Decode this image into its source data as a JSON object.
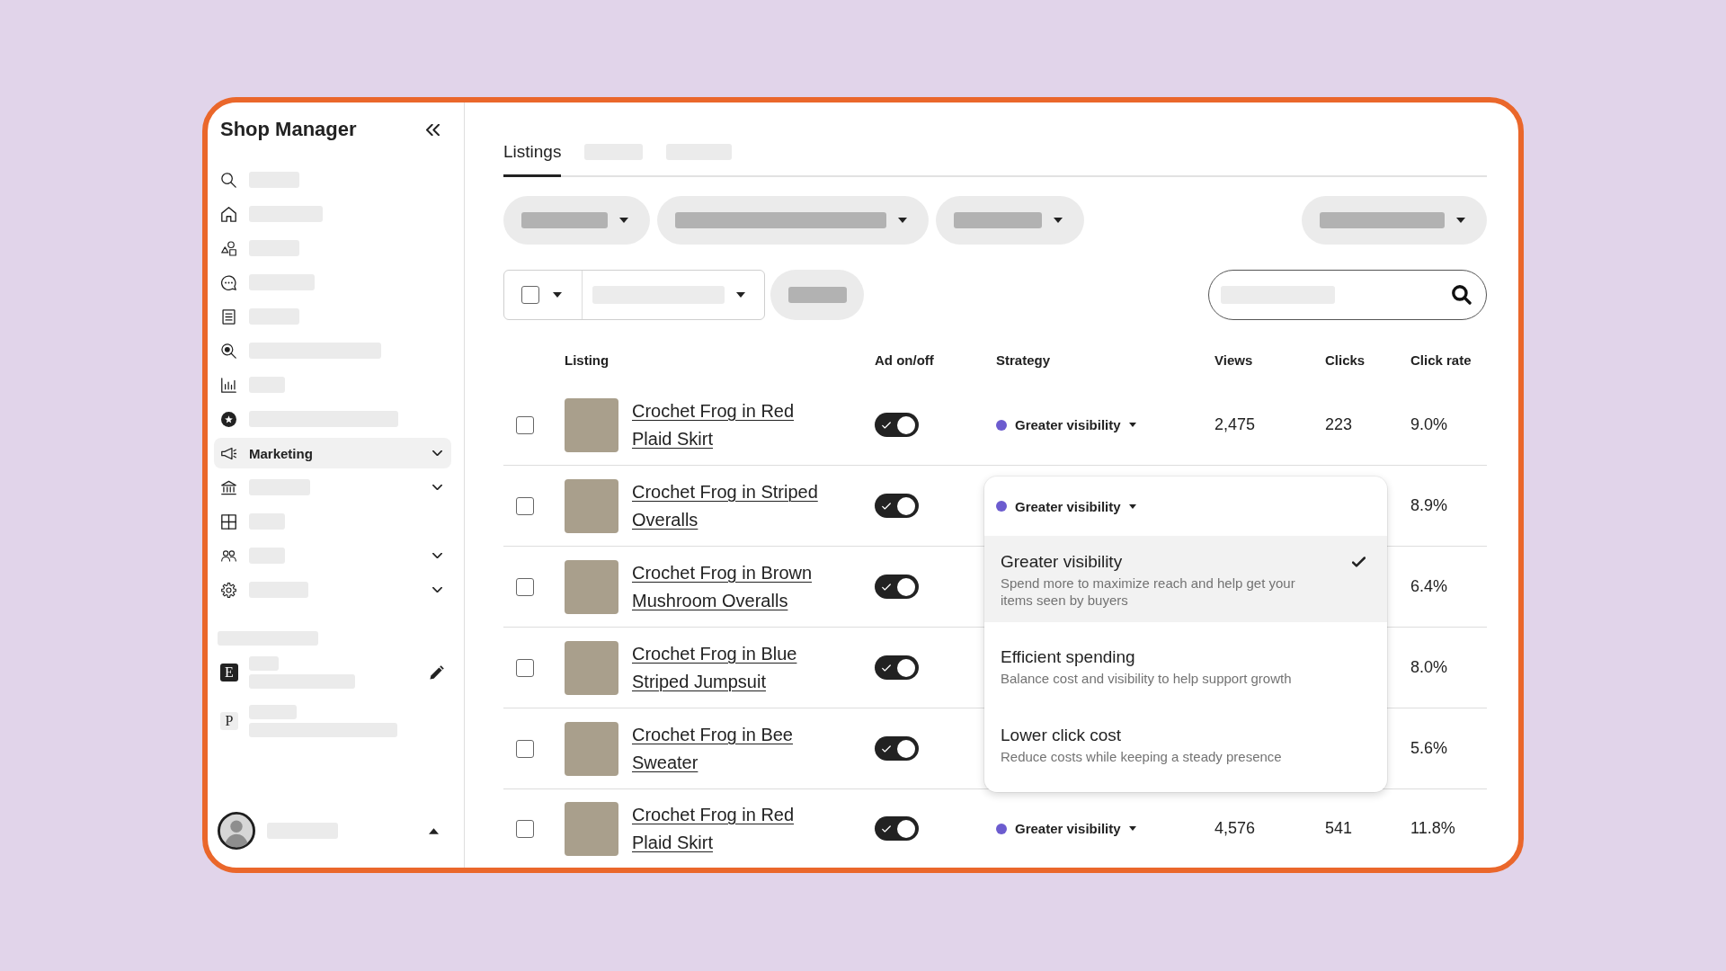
{
  "sidebar": {
    "title": "Shop Manager",
    "items": [
      {
        "kind": "redacted",
        "selected": false,
        "has_submenu": false
      },
      {
        "kind": "redacted",
        "selected": false,
        "has_submenu": false
      },
      {
        "kind": "redacted",
        "selected": false,
        "has_submenu": false
      },
      {
        "kind": "redacted",
        "selected": false,
        "has_submenu": false
      },
      {
        "kind": "redacted",
        "selected": false,
        "has_submenu": false
      },
      {
        "kind": "redacted",
        "selected": false,
        "has_submenu": false
      },
      {
        "kind": "redacted",
        "selected": false,
        "has_submenu": false
      },
      {
        "kind": "redacted",
        "selected": false,
        "has_submenu": false
      },
      {
        "kind": "text",
        "label": "Marketing",
        "selected": true,
        "has_submenu": true
      },
      {
        "kind": "redacted",
        "selected": false,
        "has_submenu": true
      },
      {
        "kind": "redacted",
        "selected": false,
        "has_submenu": false
      },
      {
        "kind": "redacted",
        "selected": false,
        "has_submenu": true
      },
      {
        "kind": "redacted",
        "selected": false,
        "has_submenu": true
      }
    ],
    "shops": {
      "heading": {
        "kind": "redacted"
      },
      "items": [
        {
          "letter": "E",
          "selected": true
        },
        {
          "letter": "P",
          "selected": false
        }
      ]
    },
    "account": {
      "kind": "redacted"
    }
  },
  "tabs": [
    {
      "kind": "text",
      "label": "Listings",
      "selected": true
    },
    {
      "kind": "redacted",
      "selected": false
    },
    {
      "kind": "redacted",
      "selected": false
    }
  ],
  "filters": [
    {
      "kind": "dropdown"
    },
    {
      "kind": "dropdown"
    },
    {
      "kind": "dropdown"
    },
    {
      "kind": "dropdown"
    }
  ],
  "toolbar": {
    "select_all": {
      "checked": false
    },
    "items": [
      {
        "kind": "dropdown"
      },
      {
        "kind": "button"
      },
      {
        "kind": "search"
      }
    ]
  },
  "table": {
    "columns": [
      "Listing",
      "Ad on/off",
      "Strategy",
      "Views",
      "Clicks",
      "Click rate"
    ],
    "rows": [
      {
        "selected": false,
        "title": "Crochet Frog in Red Plaid Skirt",
        "ad_on": true,
        "strategy": {
          "label": "Greater visibility",
          "color": "#6c5ccf",
          "expanded": false
        },
        "views": "2,475",
        "clicks": "223",
        "click_rate": "9.0%"
      },
      {
        "selected": false,
        "title": "Crochet Frog in Striped Overalls",
        "ad_on": true,
        "strategy": {
          "label": "Greater visibility",
          "color": "#6c5ccf",
          "expanded": true
        },
        "click_rate": "8.9%"
      },
      {
        "selected": false,
        "title": "Crochet Frog in Brown Mushroom Overalls",
        "ad_on": true,
        "click_rate": "6.4%"
      },
      {
        "selected": false,
        "title": "Crochet Frog in Blue Striped Jumpsuit",
        "ad_on": true,
        "click_rate": "8.0%"
      },
      {
        "selected": false,
        "title": "Crochet Frog in Bee Sweater",
        "ad_on": true,
        "click_rate": "5.6%"
      },
      {
        "selected": false,
        "title": "Crochet Frog in Red Plaid Skirt",
        "ad_on": true,
        "strategy": {
          "label": "Greater visibility",
          "color": "#6c5ccf",
          "expanded": false
        },
        "views": "4,576",
        "clicks": "541",
        "click_rate": "11.8%"
      }
    ],
    "strategy_menu": {
      "options": [
        {
          "label": "Greater visibility",
          "description": "Spend more to maximize reach and help get your items seen by buyers",
          "selected": true
        },
        {
          "label": "Efficient spending",
          "description": "Balance cost and visibility to help support growth",
          "selected": false
        },
        {
          "label": "Lower click cost",
          "description": "Reduce costs while keeping a steady presence",
          "selected": false
        }
      ]
    }
  }
}
